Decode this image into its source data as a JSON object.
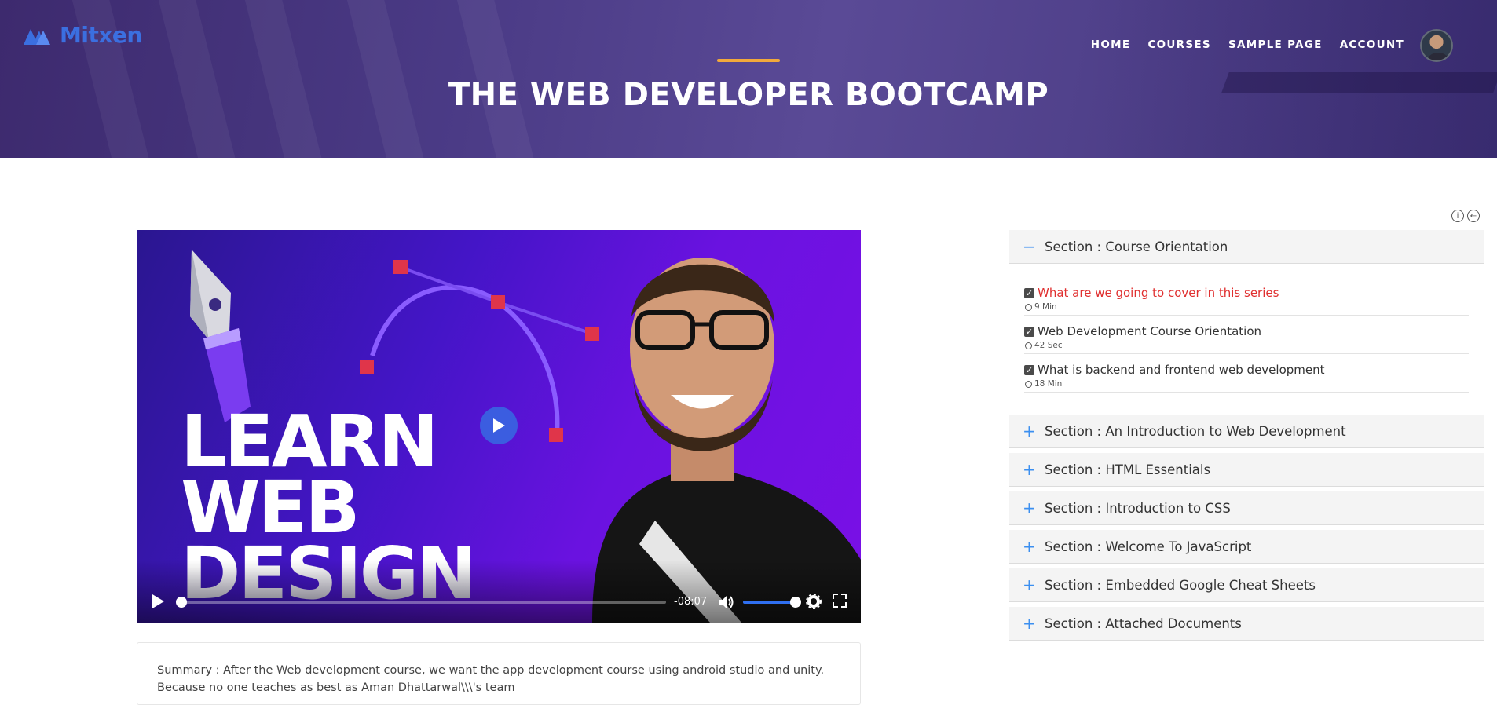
{
  "brand": {
    "name": "Mitxen",
    "color": "#3b6fe0"
  },
  "nav": {
    "items": [
      "HOME",
      "COURSES",
      "SAMPLE PAGE",
      "ACCOUNT"
    ]
  },
  "page": {
    "title": "THE WEB DEVELOPER BOOTCAMP",
    "accent_color": "#f2a93b"
  },
  "video": {
    "thumbnail_text": [
      "LEARN",
      "WEB",
      "DESIGN"
    ],
    "time_remaining": "-08:07",
    "progress_fraction": 0.0,
    "volume_fraction": 1.0
  },
  "summary": {
    "text": "Summary : After the Web development course, we want the app development course using android studio and unity. Because no one teaches as best as Aman Dhattarwal\\\\\\'s team"
  },
  "sidebar": {
    "icons": [
      "info-icon",
      "back-arrow-icon"
    ],
    "sections": [
      {
        "label": "Section : Course Orientation",
        "expanded": true,
        "sign": "−"
      },
      {
        "label": "Section : An Introduction to Web Development",
        "expanded": false,
        "sign": "+"
      },
      {
        "label": "Section : HTML Essentials",
        "expanded": false,
        "sign": "+"
      },
      {
        "label": "Section : Introduction to CSS",
        "expanded": false,
        "sign": "+"
      },
      {
        "label": "Section : Welcome To JavaScript",
        "expanded": false,
        "sign": "+"
      },
      {
        "label": "Section : Embedded Google Cheat Sheets",
        "expanded": false,
        "sign": "+"
      },
      {
        "label": "Section : Attached Documents",
        "expanded": false,
        "sign": "+"
      }
    ],
    "lessons": [
      {
        "title": "What are we going to cover in this series",
        "duration": "9 Min",
        "checked": true,
        "active": true
      },
      {
        "title": "Web Development Course Orientation",
        "duration": "42 Sec",
        "checked": true,
        "active": false
      },
      {
        "title": "What is backend and frontend web development",
        "duration": "18 Min",
        "checked": true,
        "active": false
      }
    ]
  },
  "colors": {
    "hero": "#4a3a85",
    "link_active": "#e03030",
    "accordion_sign": "#3b8ff0",
    "player_accent": "#2f6ff0"
  }
}
